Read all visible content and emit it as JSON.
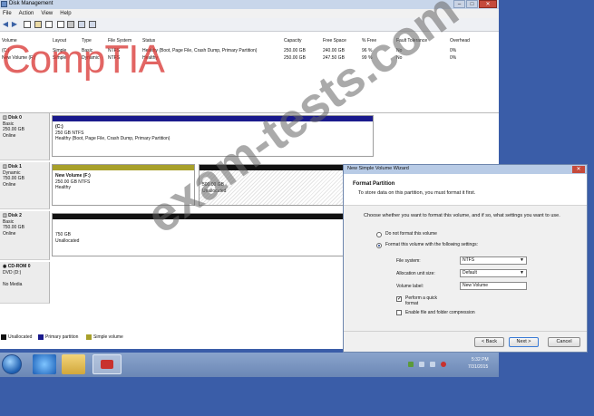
{
  "window": {
    "title": "Disk Management"
  },
  "menu": [
    "File",
    "Action",
    "View",
    "Help"
  ],
  "volumes": {
    "headers": [
      "Volume",
      "Layout",
      "Type",
      "File System",
      "Status",
      "Capacity",
      "Free Space",
      "% Free",
      "Fault Tolerance",
      "Overhead"
    ],
    "rows": [
      [
        "(C:)",
        "Simple",
        "Basic",
        "NTFS",
        "Healthy (Boot, Page File, Crash Dump, Primary Partition)",
        "250.00 GB",
        "240.00 GB",
        "96 %",
        "No",
        "0%"
      ],
      [
        "New Volume (F:)",
        "Simple",
        "Dynamic",
        "NTFS",
        "Healthy",
        "250.00 GB",
        "247.50 GB",
        "99 %",
        "No",
        "0%"
      ]
    ]
  },
  "disks": [
    {
      "name": "Disk 0",
      "type": "Basic",
      "size": "250.00 GB",
      "state": "Online",
      "parts": [
        {
          "title": "(C:)",
          "line1": "250 GB NTFS",
          "line2": "Healthy (Boot, Page File, Crash Dump, Primary Partition)"
        }
      ]
    },
    {
      "name": "Disk 1",
      "type": "Dynamic",
      "size": "750.00 GB",
      "state": "Online",
      "parts": [
        {
          "title": "New Volume (F:)",
          "line1": "250.00 GB NTFS",
          "line2": "Healthy"
        },
        {
          "title": "",
          "line1": "500.00 GB",
          "line2": "Unallocated"
        }
      ]
    },
    {
      "name": "Disk 2",
      "type": "Basic",
      "size": "750.00 GB",
      "state": "Online",
      "parts": [
        {
          "title": "",
          "line1": "750 GB",
          "line2": "Unallocated"
        }
      ]
    },
    {
      "name": "CD-ROM 0",
      "type": "DVD (D:)",
      "size": "",
      "state": "No Media",
      "parts": []
    }
  ],
  "legend": [
    "Unallocated",
    "Primary partition",
    "Simple volume"
  ],
  "colors": {
    "unallocated": "#111111",
    "primary": "#1a1a8c",
    "simple": "#a8a02a"
  },
  "wizard": {
    "title": "New Simple Volume Wizard",
    "heading": "Format Partition",
    "subheading": "To store data on this partition, you must format it first.",
    "question": "Choose whether you want to format this volume, and if so, what settings you want to use.",
    "opt_noformat": "Do not format this volume",
    "opt_format": "Format this volume with the following settings:",
    "fs_label": "File system:",
    "fs_value": "NTFS",
    "alloc_label": "Allocation unit size:",
    "alloc_value": "Default",
    "vol_label": "Volume label:",
    "vol_value": "New Volume",
    "quick_format": "Perform a quick format",
    "compression": "Enable file and folder compression",
    "back": "< Back",
    "next": "Next >",
    "cancel": "Cancel"
  },
  "tray": {
    "time": "5:32 PM",
    "date": "7/31/2015"
  },
  "watermarks": {
    "brand": "CompTIA",
    "site": "exam-tests.com"
  }
}
